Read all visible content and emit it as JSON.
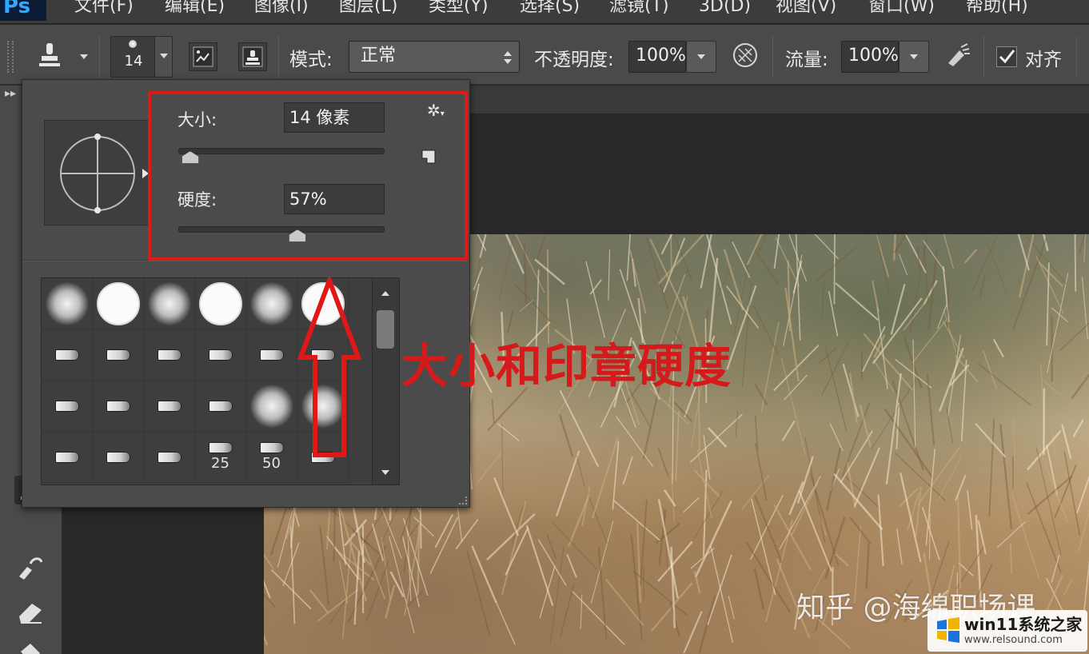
{
  "app": {
    "logo": "Ps"
  },
  "menu": [
    "文件(F)",
    "编辑(E)",
    "图像(I)",
    "图层(L)",
    "类型(Y)",
    "选择(S)",
    "滤镜(T)",
    "3D(D)",
    "视图(V)",
    "窗口(W)",
    "帮助(H)"
  ],
  "options": {
    "brush_size": "14",
    "mode_label": "模式:",
    "mode_value": "正常",
    "opacity_label": "不透明度:",
    "opacity_value": "100%",
    "flow_label": "流量:",
    "flow_value": "100%",
    "align_label": "对齐",
    "align_checked": true
  },
  "brush_picker": {
    "size_label": "大小:",
    "size_value": "14 像素",
    "size_slider": 0.05,
    "hardness_label": "硬度:",
    "hardness_value": "57%",
    "hardness_slider": 0.57,
    "presets": [
      {
        "kind": "soft"
      },
      {
        "kind": "hard"
      },
      {
        "kind": "soft"
      },
      {
        "kind": "hard"
      },
      {
        "kind": "soft"
      },
      {
        "kind": "hard"
      },
      {
        "kind": "brush-a"
      },
      {
        "kind": "brush-b"
      },
      {
        "kind": "brush-c"
      },
      {
        "kind": "brush-d"
      },
      {
        "kind": "brush-e"
      },
      {
        "kind": "brush-f"
      },
      {
        "kind": "brush-g"
      },
      {
        "kind": "brush-h"
      },
      {
        "kind": "brush-i"
      },
      {
        "kind": "brush-j"
      },
      {
        "kind": "soft"
      },
      {
        "kind": "soft"
      },
      {
        "kind": "brush-k"
      },
      {
        "kind": "brush-k"
      },
      {
        "kind": "brush-l"
      },
      {
        "kind": "brush-m",
        "num": "25"
      },
      {
        "kind": "brush-n",
        "num": "50"
      },
      {
        "kind": "brush-o"
      }
    ]
  },
  "annotation": {
    "text": "大小和印章硬度",
    "color": "#d41a1a"
  },
  "watermarks": {
    "zhihu": "知乎 @海绵职场课",
    "site_title": "win11系统之家",
    "site_url": "www.relsound.com"
  }
}
